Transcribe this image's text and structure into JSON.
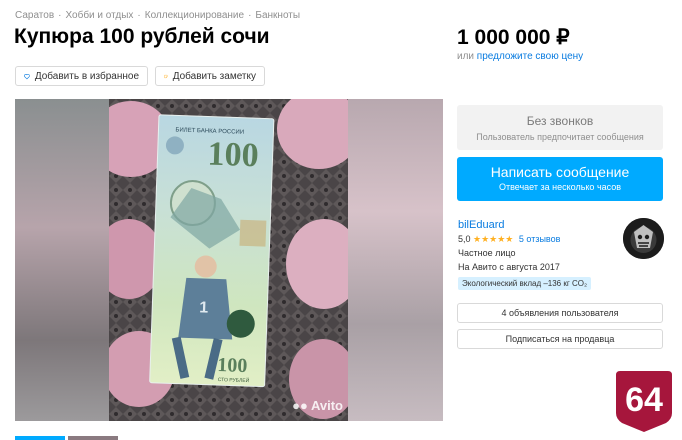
{
  "breadcrumbs": [
    "Саратов",
    "Хобби и отдых",
    "Коллекционирование",
    "Банкноты"
  ],
  "title": "Купюра 100 рублей сочи",
  "price": {
    "value": "1 000 000 ₽",
    "note_prefix": "или",
    "note_link": "предложите свою цену"
  },
  "actions": {
    "favorite": "Добавить в избранное",
    "note": "Добавить заметку"
  },
  "gallery": {
    "watermark": "Avito",
    "banknote": {
      "bank_label": "БИЛЕТ БАНКА РОССИИ",
      "denomination": "100",
      "bottom_text": "СТО РУБЛЕЙ"
    }
  },
  "contact": {
    "no_calls_title": "Без звонков",
    "no_calls_note": "Пользователь предпочитает сообщения",
    "write_title": "Написать сообщение",
    "write_note": "Отвечает за несколько часов"
  },
  "seller": {
    "name": "bilEduard",
    "rating_value": "5,0",
    "stars": "★★★★★",
    "reviews": "5 отзывов",
    "type": "Частное лицо",
    "since": "На Авито с августа 2017",
    "eco_badge": "Экологический вклад –136 кг CO₂"
  },
  "buttons": {
    "listings": "4 объявления пользователя",
    "subscribe": "Подписаться на продавца"
  },
  "logo": {
    "text": "64",
    "color": "#a6163c"
  },
  "colors": {
    "accent": "#00aaff",
    "link": "#0a7ce0",
    "star": "#ffb021"
  }
}
